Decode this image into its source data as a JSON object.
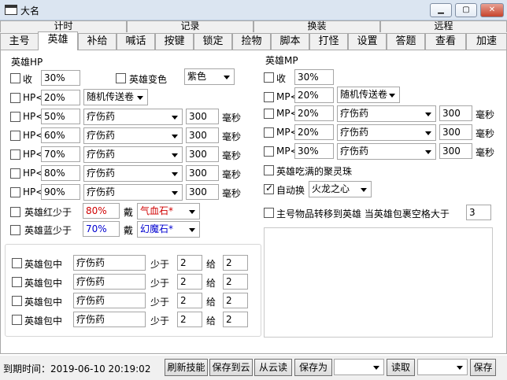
{
  "window": {
    "title": "大名"
  },
  "tabs_row1": [
    "计时",
    "记录",
    "换装",
    "远程"
  ],
  "tabs_row2": [
    "主号",
    "英雄",
    "补给",
    "喊话",
    "按键",
    "锁定",
    "捡物",
    "脚本",
    "打怪",
    "设置",
    "答题",
    "查看",
    "加速"
  ],
  "hero_hp": {
    "title": "英雄HP",
    "shou": {
      "label": "收",
      "value": "30%",
      "checked": false
    },
    "transform": {
      "label": "英雄变色",
      "checked": false,
      "color": "紫色"
    },
    "scroll_row": {
      "label": "HP<",
      "value": "20%",
      "item": "随机传送卷"
    },
    "rows": [
      {
        "label": "HP<",
        "value": "50%",
        "item": "疗伤药",
        "ms": "300",
        "unit": "毫秒"
      },
      {
        "label": "HP<",
        "value": "60%",
        "item": "疗伤药",
        "ms": "300",
        "unit": "毫秒"
      },
      {
        "label": "HP<",
        "value": "70%",
        "item": "疗伤药",
        "ms": "300",
        "unit": "毫秒"
      },
      {
        "label": "HP<",
        "value": "80%",
        "item": "疗伤药",
        "ms": "300",
        "unit": "毫秒"
      },
      {
        "label": "HP<",
        "value": "90%",
        "item": "疗伤药",
        "ms": "300",
        "unit": "毫秒"
      }
    ],
    "red": {
      "label": "英雄红少于",
      "value": "80%",
      "wear": "戴",
      "item": "气血石*",
      "value_color": "#d00000",
      "item_color": "#d00000"
    },
    "blue": {
      "label": "英雄蓝少于",
      "value": "70%",
      "wear": "戴",
      "item": "幻魔石*",
      "value_color": "#0000d0",
      "item_color": "#0000d0"
    }
  },
  "hero_mp": {
    "title": "英雄MP",
    "shou": {
      "label": "收",
      "value": "30%"
    },
    "scroll_row": {
      "label": "MP<",
      "value": "20%",
      "item": "随机传送卷"
    },
    "rows": [
      {
        "label": "MP<",
        "value": "20%",
        "item": "疗伤药",
        "ms": "300",
        "unit": "毫秒"
      },
      {
        "label": "MP<",
        "value": "20%",
        "item": "疗伤药",
        "ms": "300",
        "unit": "毫秒"
      },
      {
        "label": "MP<",
        "value": "30%",
        "item": "疗伤药",
        "ms": "300",
        "unit": "毫秒"
      }
    ],
    "eat_bead": {
      "label": "英雄吃满的聚灵珠",
      "checked": false
    },
    "auto_swap": {
      "label": "自动换",
      "checked": true,
      "item": "火龙之心"
    },
    "transfer": {
      "label": "主号物品转移到英雄 当英雄包裹空格大于",
      "value": "3"
    }
  },
  "bag": {
    "rows": [
      {
        "label": "英雄包中",
        "item": "疗伤药",
        "less": "少于",
        "qty": "2",
        "give": "给",
        "give_qty": "2"
      },
      {
        "label": "英雄包中",
        "item": "疗伤药",
        "less": "少于",
        "qty": "2",
        "give": "给",
        "give_qty": "2"
      },
      {
        "label": "英雄包中",
        "item": "疗伤药",
        "less": "少于",
        "qty": "2",
        "give": "给",
        "give_qty": "2"
      },
      {
        "label": "英雄包中",
        "item": "疗伤药",
        "less": "少于",
        "qty": "2",
        "give": "给",
        "give_qty": "2"
      }
    ]
  },
  "status": {
    "expire": "到期时间：2019-06-10 20:19:02",
    "refresh": "刷新技能",
    "save_cloud": "保存到云",
    "from_cloud": "从云读",
    "save_as": "保存为",
    "read": "读取",
    "save": "保存"
  }
}
